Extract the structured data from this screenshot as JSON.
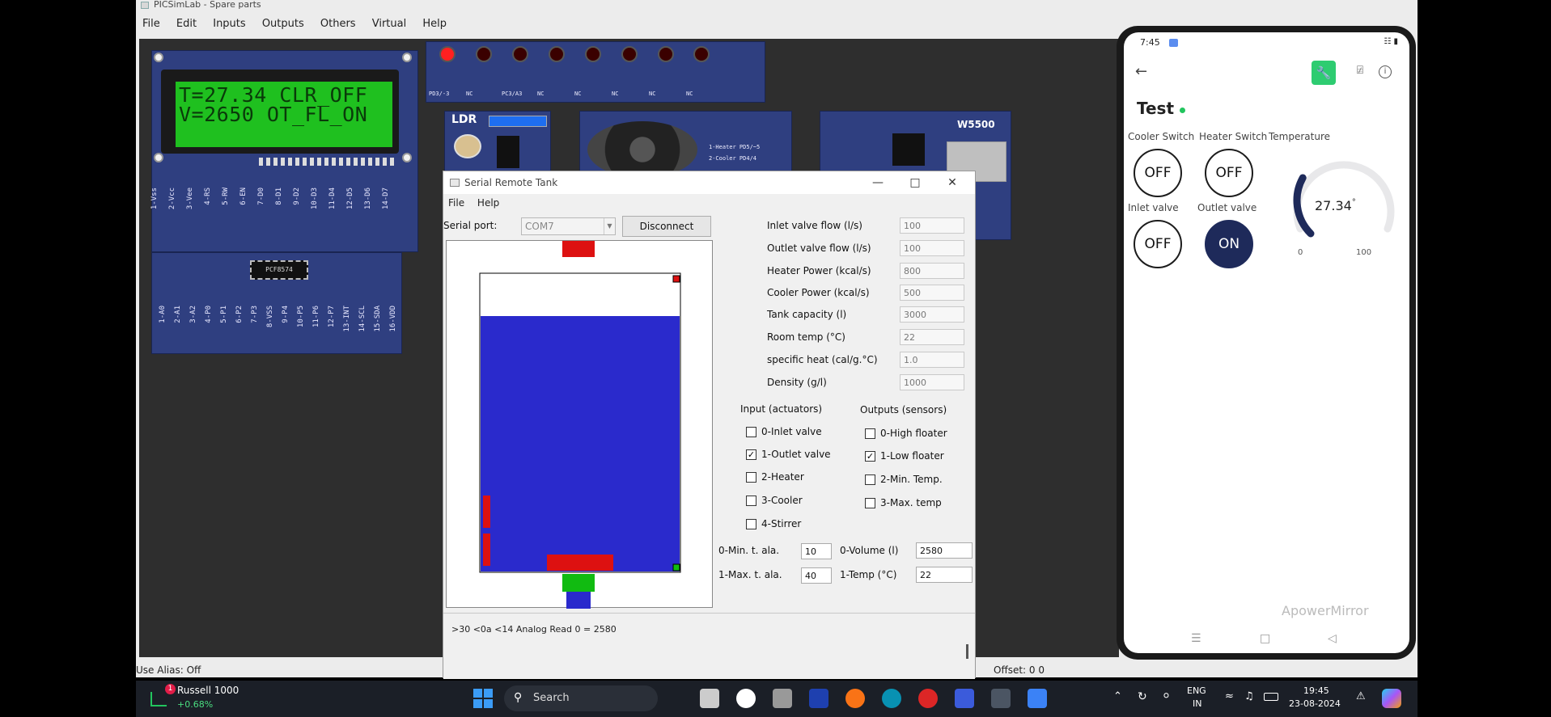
{
  "picsimlab": {
    "title": "PICSimLab - Spare parts",
    "menu": [
      "File",
      "Edit",
      "Inputs",
      "Outputs",
      "Others",
      "Virtual",
      "Help"
    ],
    "status_alias": "Use Alias: Off",
    "status_offset": "Offset:  0  0",
    "lcd": {
      "line1": "T=27.34 CLR_OFF",
      "line2": "V=2650 OT_FL_ON"
    },
    "lcd_pins": [
      "1-Vss",
      "2-Vcc",
      "3-Vee",
      "4-RS",
      "5-RW",
      "6-EN",
      "7-D0",
      "8-D1",
      "9-D2",
      "10-D3",
      "11-D4",
      "12-D5",
      "13-D6",
      "14-D7"
    ],
    "pcf_chip": "PCF8574",
    "pcf_pins": [
      "1-A0",
      "2-A1",
      "3-A2",
      "4-P0",
      "5-P1",
      "6-P2",
      "7-P3",
      "8-VSS",
      "9-P4",
      "10-P5",
      "11-P6",
      "12-P7",
      "13-INT",
      "14-SCL",
      "15-SDA",
      "16-VDD"
    ],
    "led_labels": [
      "PD3/-3",
      "NC",
      "PC3/A3",
      "NC",
      "NC",
      "NC",
      "NC",
      "NC"
    ],
    "ldr_label": "LDR",
    "fan_labels": [
      "1-Heater PD5/~5",
      "2-Cooler PD4/4"
    ],
    "w5500_label": "W5500"
  },
  "serial_tank": {
    "title": "Serial Remote Tank",
    "menu": [
      "File",
      "Help"
    ],
    "serial_port_label": "Serial port:",
    "serial_port_value": "COM7",
    "disconnect_label": "Disconnect",
    "params": [
      {
        "label": "Inlet valve flow (l/s)",
        "value": "100"
      },
      {
        "label": "Outlet valve flow (l/s)",
        "value": "100"
      },
      {
        "label": "Heater Power (kcal/s)",
        "value": "800"
      },
      {
        "label": "Cooler Power (kcal/s)",
        "value": "500"
      },
      {
        "label": "Tank capacity (l)",
        "value": "3000"
      },
      {
        "label": "Room temp (°C)",
        "value": "22"
      },
      {
        "label": "specific heat (cal/g.°C)",
        "value": "1.0"
      },
      {
        "label": "Density (g/l)",
        "value": "1000"
      }
    ],
    "inputs_title": "Input (actuators)",
    "outputs_title": "Outputs (sensors)",
    "inputs": [
      {
        "label": "0-Inlet valve",
        "checked": false
      },
      {
        "label": "1-Outlet valve",
        "checked": true
      },
      {
        "label": "2-Heater",
        "checked": false
      },
      {
        "label": "3-Cooler",
        "checked": false
      },
      {
        "label": "4-Stirrer",
        "checked": false
      }
    ],
    "outputs": [
      {
        "label": "0-High floater",
        "checked": false
      },
      {
        "label": "1-Low floater",
        "checked": true
      },
      {
        "label": "2-Min. Temp.",
        "checked": false
      },
      {
        "label": "3-Max. temp",
        "checked": false
      }
    ],
    "min_label": "0-Min. t. ala.",
    "min_value": "10",
    "max_label": "1-Max. t. ala.",
    "max_value": "40",
    "volume_label": "0-Volume (l)",
    "volume_value": "2580",
    "temp_label": "1-Temp (°C)",
    "temp_value": "22",
    "log_text": ">30 <0a <14  Analog Read 0 = 2580",
    "water_level": 0.86
  },
  "phone": {
    "time": "7:45",
    "device_title": "Test",
    "watermark": "ApowerMirror",
    "cooler_switch": {
      "label": "Cooler Switch",
      "state": "OFF"
    },
    "heater_switch": {
      "label": "Heater Switch",
      "state": "OFF"
    },
    "inlet_valve": {
      "label": "Inlet valve",
      "state": "OFF"
    },
    "outlet_valve": {
      "label": "Outlet valve",
      "state": "ON"
    },
    "gauge": {
      "label": "Temperature",
      "value": "27.34",
      "unit": "°",
      "min": "0",
      "max": "100",
      "fraction": 0.2734
    }
  },
  "taskbar": {
    "stock_name": "Russell 1000",
    "stock_change": "+0.68%",
    "stock_badge": "1",
    "search_label": "Search",
    "lang1": "ENG",
    "lang2": "IN",
    "time": "19:45",
    "date": "23-08-2024"
  },
  "colors": {
    "pcb_blue": "#2f3f80",
    "lcd_green": "#1fc01f",
    "water_blue": "#2a2acc",
    "valve_red": "#dd1111",
    "valve_green": "#11bb11",
    "phone_accent": "#1e2a5a",
    "online_green": "#22c55e",
    "tool_green": "#2ecc71"
  }
}
